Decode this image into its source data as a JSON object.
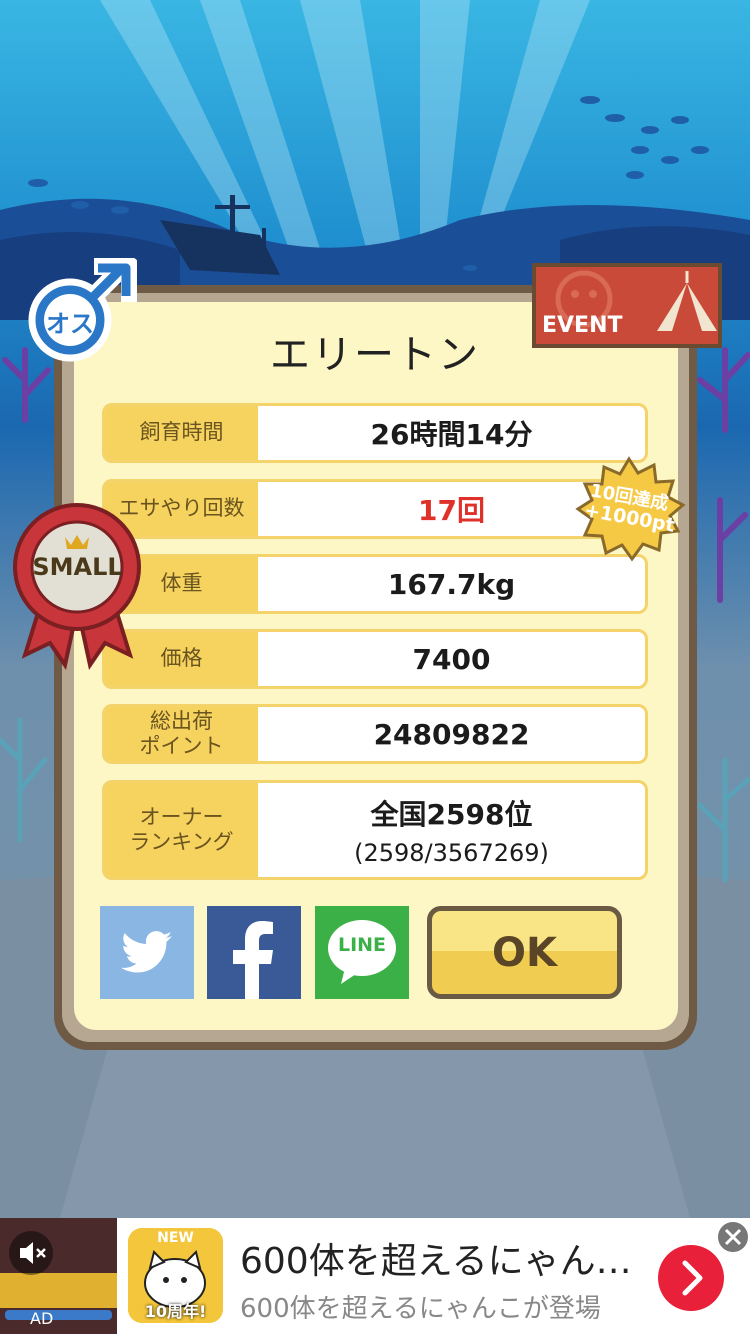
{
  "creature": {
    "name": "エリートン",
    "gender_label": "オス",
    "size_label": "SMALL",
    "event_label": "EVENT"
  },
  "stats": [
    {
      "label": "飼育時間",
      "value": "26時間14分"
    },
    {
      "label": "エサやり回数",
      "value": "17回",
      "highlight_color": "#e0302a"
    },
    {
      "label": "体重",
      "value": "167.7kg"
    },
    {
      "label": "価格",
      "value": "7400"
    },
    {
      "label": "総出荷\nポイント",
      "value": "24809822"
    },
    {
      "label": "オーナー\nランキング",
      "value": "全国2598位",
      "sub_value": "(2598/3567269)"
    }
  ],
  "bonus_badge": {
    "line1": "10回達成",
    "line2": "+1000pt"
  },
  "share": {
    "twitter_icon": "twitter-bird-icon",
    "facebook_icon": "facebook-f-icon",
    "line_label": "LINE"
  },
  "ok_button": {
    "label": "OK"
  },
  "ad": {
    "label": "AD",
    "title": "600体を超えるにゃん…",
    "subtitle": "600体を超えるにゃんこが登場",
    "icon_badge": "10周年!",
    "icon_top": "NEW"
  },
  "colors": {
    "label_bg": "#f6d25e",
    "card_bg": "#fdf7c6",
    "border": "#6e5a45",
    "accent_red": "#e0302a"
  }
}
